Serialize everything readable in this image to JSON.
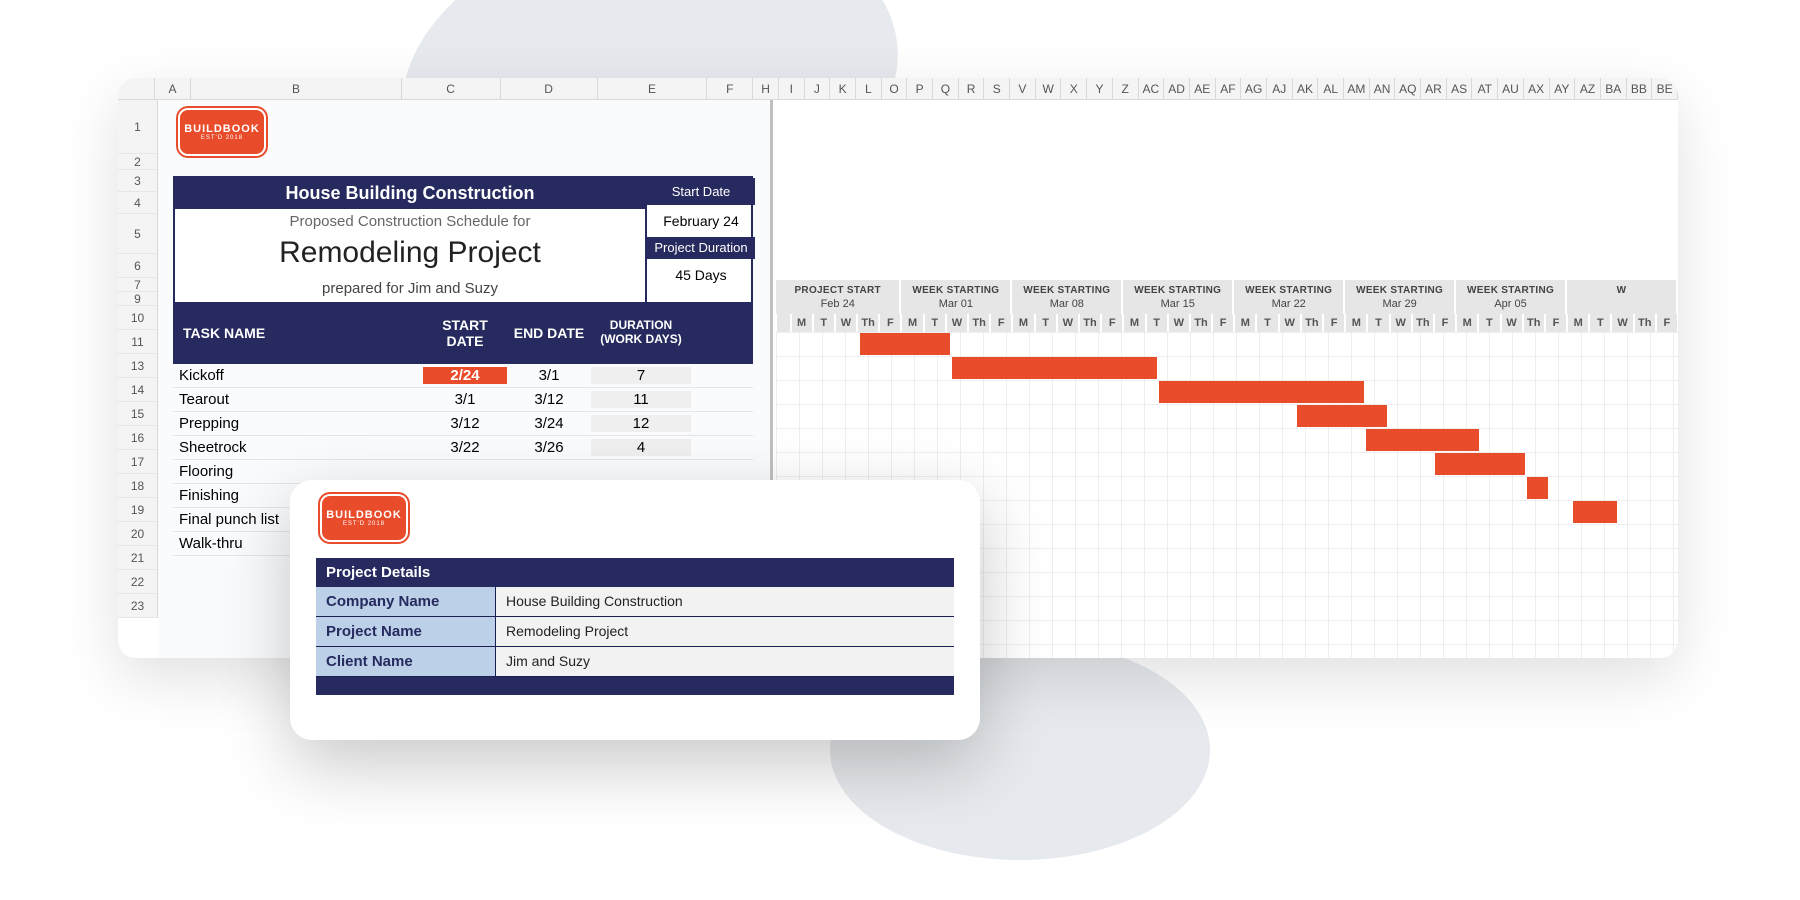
{
  "logo": {
    "name": "BUILDBOOK",
    "tag": "EST'D 2018"
  },
  "header": {
    "title": "House Building Construction",
    "subtitle": "Proposed Construction Schedule for",
    "project": "Remodeling Project",
    "prepared": "prepared for Jim and Suzy",
    "start_date_label": "Start Date",
    "start_date": "February 24",
    "duration_label": "Project Duration",
    "duration": "45 Days"
  },
  "columns": {
    "letters": [
      "A",
      "B",
      "C",
      "D",
      "E",
      "F",
      "H",
      "I",
      "J",
      "K",
      "L",
      "O",
      "P",
      "Q",
      "R",
      "S",
      "V",
      "W",
      "X",
      "Y",
      "Z",
      "AC",
      "AD",
      "AE",
      "AF",
      "AG",
      "AJ",
      "AK",
      "AL",
      "AM",
      "AN",
      "AQ",
      "AR",
      "AS",
      "AT",
      "AU",
      "AX",
      "AY",
      "AZ",
      "BA",
      "BB",
      "BE"
    ]
  },
  "rows": [
    1,
    2,
    3,
    4,
    5,
    6,
    7,
    9,
    10,
    11,
    13,
    14,
    15,
    16,
    17,
    18,
    19,
    20,
    21,
    22,
    23
  ],
  "table_head": {
    "name": "TASK NAME",
    "start": "START DATE",
    "end": "END DATE",
    "dur": "DURATION (WORK DAYS)"
  },
  "tasks": [
    {
      "name": "Kickoff",
      "start": "2/24",
      "end": "3/1",
      "dur": "7",
      "hl": true,
      "gx_start": 3,
      "gx_len": 4
    },
    {
      "name": "Tearout",
      "start": "3/1",
      "end": "3/12",
      "dur": "11",
      "hl": false,
      "gx_start": 7,
      "gx_len": 9
    },
    {
      "name": "Prepping",
      "start": "3/12",
      "end": "3/24",
      "dur": "12",
      "hl": false,
      "gx_start": 16,
      "gx_len": 9
    },
    {
      "name": "Sheetrock",
      "start": "3/22",
      "end": "3/26",
      "dur": "4",
      "hl": false,
      "gx_start": 22,
      "gx_len": 4
    },
    {
      "name": "Flooring",
      "start": "",
      "end": "",
      "dur": "",
      "hl": false,
      "gx_start": 25,
      "gx_len": 5
    },
    {
      "name": "Finishing",
      "start": "",
      "end": "",
      "dur": "",
      "hl": false,
      "gx_start": 28,
      "gx_len": 4
    },
    {
      "name": "Final punch list",
      "start": "",
      "end": "",
      "dur": "",
      "hl": false,
      "gx_start": 32,
      "gx_len": 1
    },
    {
      "name": "Walk-thru",
      "start": "",
      "end": "",
      "dur": "",
      "hl": false,
      "gx_start": 34,
      "gx_len": 2
    }
  ],
  "weeks": [
    {
      "title": "PROJECT START",
      "date": "Feb 24",
      "first": true
    },
    {
      "title": "WEEK STARTING",
      "date": "Mar 01"
    },
    {
      "title": "WEEK STARTING",
      "date": "Mar 08"
    },
    {
      "title": "WEEK STARTING",
      "date": "Mar 15"
    },
    {
      "title": "WEEK STARTING",
      "date": "Mar 22"
    },
    {
      "title": "WEEK STARTING",
      "date": "Mar 29"
    },
    {
      "title": "WEEK STARTING",
      "date": "Apr 05"
    },
    {
      "title": "W",
      "date": ""
    }
  ],
  "day_labels_lead": [
    "M",
    "T",
    "W",
    "Th",
    "F"
  ],
  "day_labels_rep": [
    "M",
    "T",
    "W",
    "Th",
    "F"
  ],
  "details": {
    "head": "Project Details",
    "rows": [
      {
        "k": "Company Name",
        "v": "House Building Construction"
      },
      {
        "k": "Project Name",
        "v": "Remodeling Project"
      },
      {
        "k": "Client Name",
        "v": "Jim and Suzy"
      }
    ]
  },
  "colors": {
    "navy": "#262a5e",
    "accent": "#e84c2b"
  }
}
